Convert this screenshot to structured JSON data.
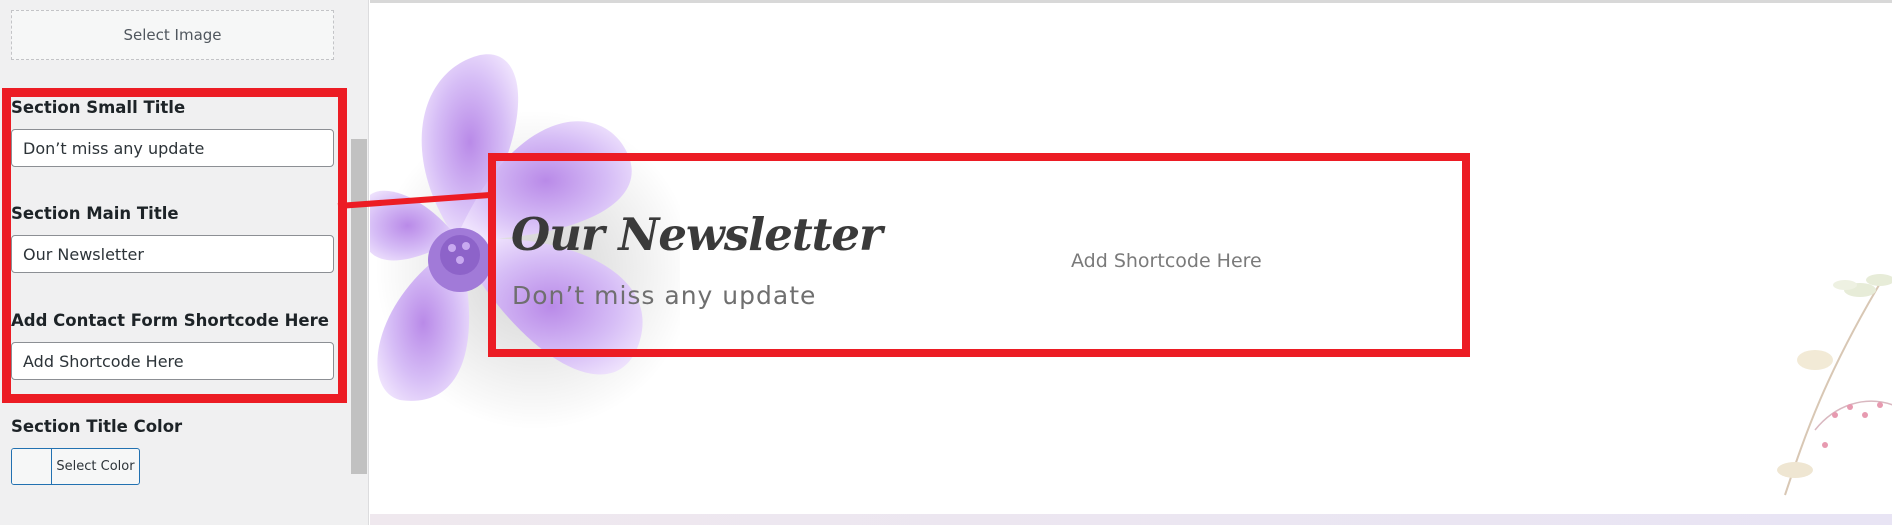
{
  "panel": {
    "select_image_label": "Select Image",
    "fields": {
      "small_title": {
        "label": "Section Small Title",
        "value": "Don’t miss any update"
      },
      "main_title": {
        "label": "Section Main Title",
        "value": "Our Newsletter"
      },
      "shortcode": {
        "label": "Add Contact Form Shortcode Here",
        "value": "Add Shortcode Here"
      },
      "title_color": {
        "label": "Section Title Color",
        "button_label": "Select Color"
      }
    }
  },
  "preview": {
    "title": "Our Newsletter",
    "subtitle": "Don’t miss any update",
    "shortcode_placeholder": "Add Shortcode Here"
  },
  "colors": {
    "annotation_red": "#ec1c24",
    "panel_bg": "#f0f0f1",
    "accent_blue": "#2271b1",
    "flower_purple": "#c9a6f2"
  },
  "icons": [
    "purple-flower-illustration",
    "twig-illustration"
  ]
}
